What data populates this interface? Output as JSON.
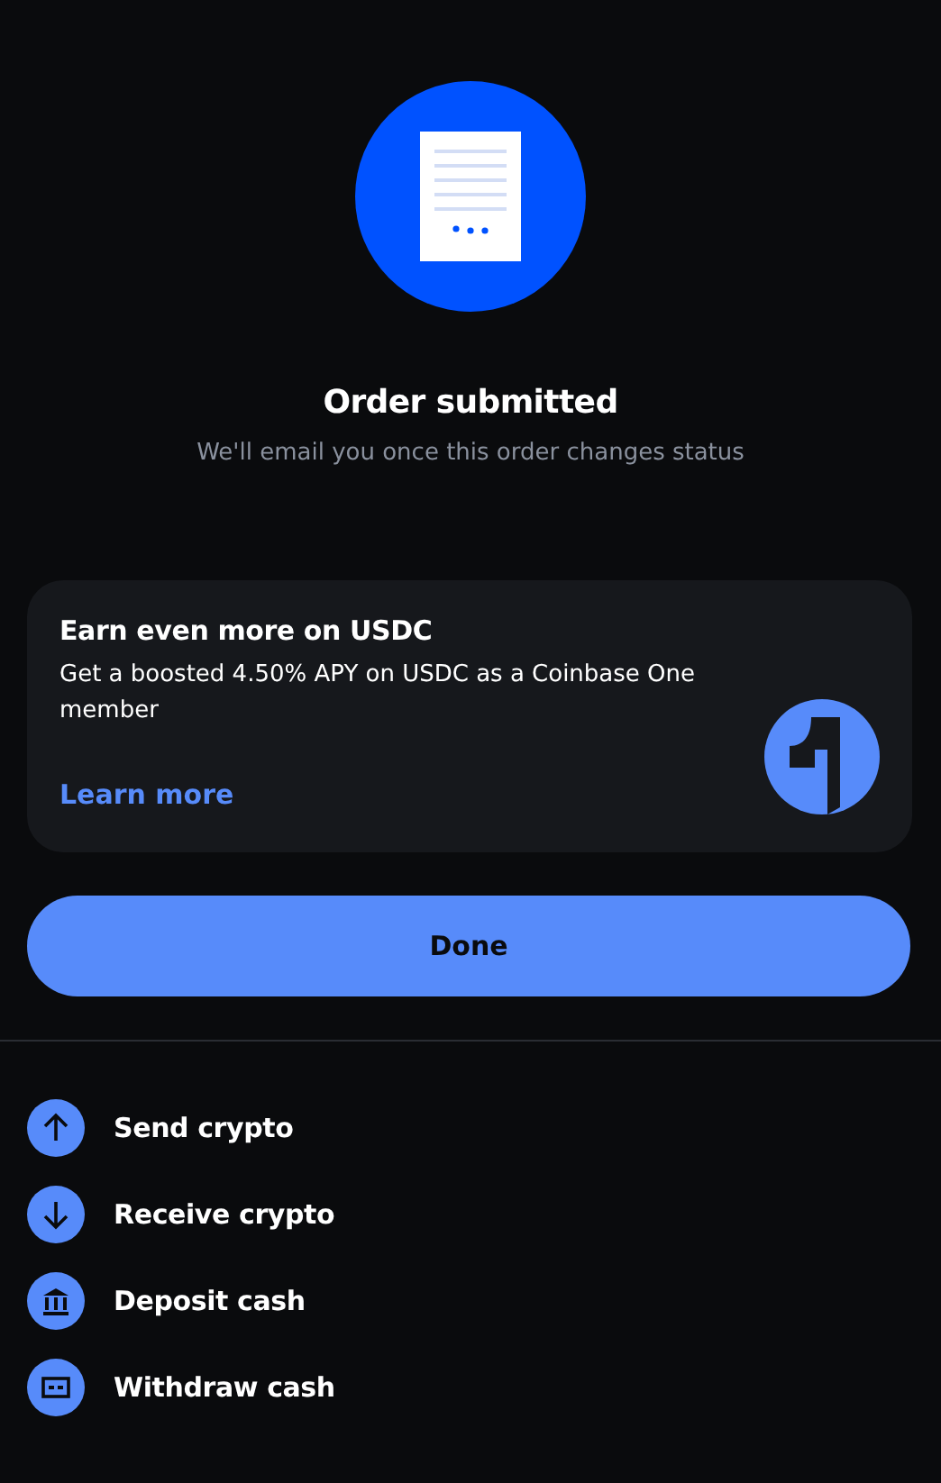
{
  "header": {
    "title": "Order submitted",
    "subtitle": "We'll email you once this order changes status"
  },
  "promo": {
    "title": "Earn even more on USDC",
    "body": "Get a boosted 4.50% APY on USDC as a Coinbase One member",
    "link": "Learn more"
  },
  "done_button": "Done",
  "actions": [
    {
      "kind": "send",
      "label": "Send crypto"
    },
    {
      "kind": "receive",
      "label": "Receive crypto"
    },
    {
      "kind": "deposit",
      "label": "Deposit cash"
    },
    {
      "kind": "withdraw",
      "label": "Withdraw cash"
    }
  ]
}
